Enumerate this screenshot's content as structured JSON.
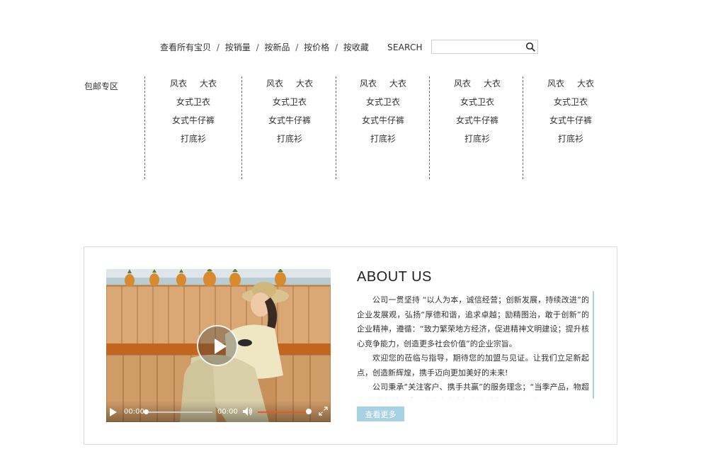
{
  "nav": {
    "browse_all": "查看所有宝贝",
    "sort_options": [
      "按销量",
      "按新品",
      "按价格",
      "按收藏"
    ],
    "separator": "/",
    "search_label": "SEARCH",
    "search_value": ""
  },
  "categories": {
    "free_shipping_label": "包邮专区",
    "columns": [
      {
        "items": [
          "风衣",
          "大衣",
          "女式卫衣",
          "女式牛仔裤",
          "打底衫"
        ]
      },
      {
        "items": [
          "风衣",
          "大衣",
          "女式卫衣",
          "女式牛仔裤",
          "打底衫"
        ]
      },
      {
        "items": [
          "风衣",
          "大衣",
          "女式卫衣",
          "女式牛仔裤",
          "打底衫"
        ]
      },
      {
        "items": [
          "风衣",
          "大衣",
          "女式卫衣",
          "女式牛仔裤",
          "打底衫"
        ]
      },
      {
        "items": [
          "风衣",
          "大衣",
          "女式卫衣",
          "女式牛仔裤",
          "打底衫"
        ]
      }
    ]
  },
  "about": {
    "title": "ABOUT US",
    "paragraphs": [
      "公司一贯坚持 “以人为本，诚信经营；创新发展，持续改进”的企业发展观，弘扬“厚德和谐，追求卓越；励精图治，敢于创新”的企业精神，遵循：“致力繁荣地方经济，促进精神文明建设；提升核心竞争能力，创造更多社会价值”的企业宗旨。",
      "欢迎您的莅临与指导，期待您的加盟与见证。让我们立足新起点，创造新辉煌，携手迈向更加美好的未来!",
      "公司秉承“关注客户、携手共赢”的服务理念；“当季产品，物超所值”的经营理念，为广大客户提供优质的产品和服务。"
    ],
    "more_label": "查看更多"
  },
  "video": {
    "time_current": "00:00",
    "time_total": "00:00",
    "progress": 0,
    "volume": 0.9,
    "colors": {
      "volume_bar": "#e05a2a",
      "button": "#a6d2e3"
    }
  }
}
